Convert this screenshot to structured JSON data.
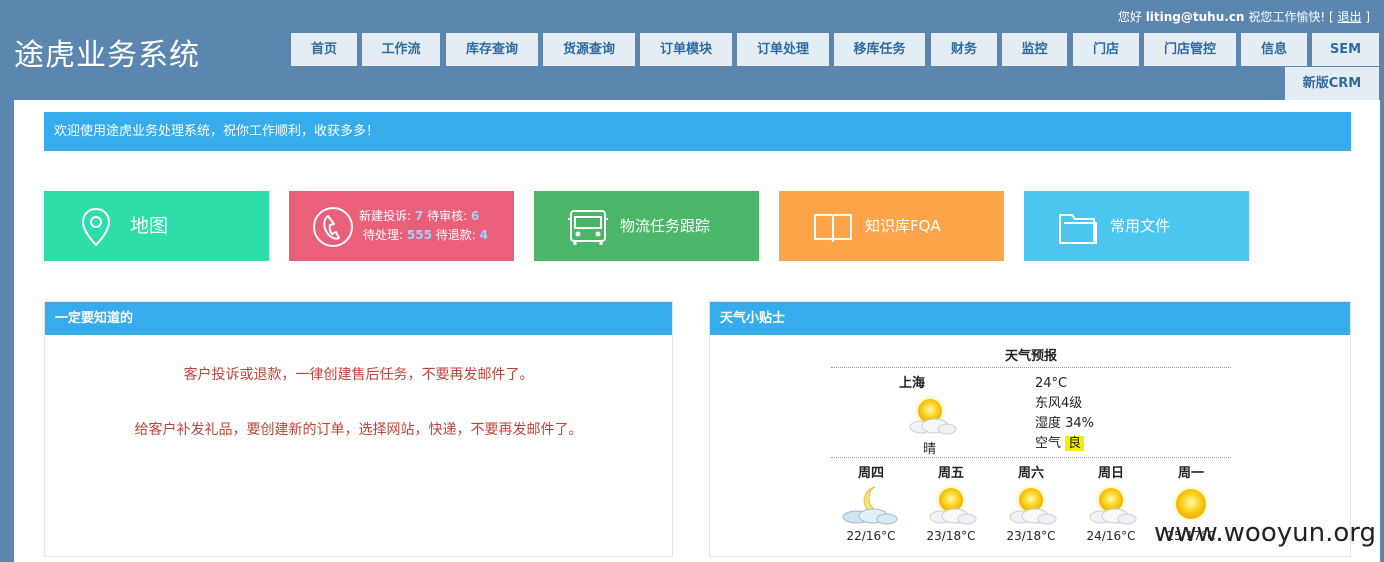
{
  "app": {
    "title": "途虎业务系统"
  },
  "userbar": {
    "greeting": "您好",
    "user": "liting@tuhu.cn",
    "wish": "祝您工作愉快!",
    "bracket_open": "[",
    "logout": "退出",
    "bracket_close": "]"
  },
  "nav": {
    "tabs": [
      "首页",
      "工作流",
      "库存查询",
      "货源查询",
      "订单模块",
      "订单处理",
      "移库任务",
      "财务",
      "监控",
      "门店",
      "门店管控",
      "信息",
      "SEM",
      "新版CRM"
    ]
  },
  "welcome": "欢迎使用途虎业务处理系统，祝你工作顺利，收获多多！",
  "tiles": {
    "map": "地图",
    "complaints": {
      "new_label": "新建投诉:",
      "new_count": "7",
      "review_label": "待审核:",
      "review_count": "6",
      "pending_label": "待处理:",
      "pending_count": "555",
      "refund_label": "待退款:",
      "refund_count": "4"
    },
    "logistics": "物流任务跟踪",
    "kb": "知识库FQA",
    "files": "常用文件"
  },
  "notice_panel": {
    "title": "一定要知道的",
    "line1": "客户投诉或退款，一律创建售后任务，不要再发邮件了。",
    "line2": "给客户补发礼品，要创建新的订单，选择网站，快递，不要再发邮件了。"
  },
  "weather_panel": {
    "title": "天气小贴士",
    "forecast_title": "天气预报",
    "city": "上海",
    "condition": "晴",
    "temp": "24°C",
    "wind": "东风4级",
    "humidity": "湿度 34%",
    "air_label": "空气",
    "air_value": "良",
    "days": [
      {
        "day": "周四",
        "temp": "22/16°C",
        "icon": "moon-cloud-icon"
      },
      {
        "day": "周五",
        "temp": "23/18°C",
        "icon": "sun-cloud-icon"
      },
      {
        "day": "周六",
        "temp": "23/18°C",
        "icon": "sun-cloud-icon"
      },
      {
        "day": "周日",
        "temp": "24/16°C",
        "icon": "sun-cloud-icon"
      },
      {
        "day": "周一",
        "temp": "25/17°C",
        "icon": "sun-icon"
      }
    ]
  },
  "watermark": "www.wooyun.org",
  "colors": {
    "header_bg": "#5b86b0",
    "accent_blue": "#36acec",
    "tile_map": "#2ddea9",
    "tile_complaints": "#ea5f79",
    "tile_logistics": "#4ab768",
    "tile_kb": "#fda44a",
    "tile_files": "#4cc6ef",
    "notice_text": "#c0443a"
  }
}
